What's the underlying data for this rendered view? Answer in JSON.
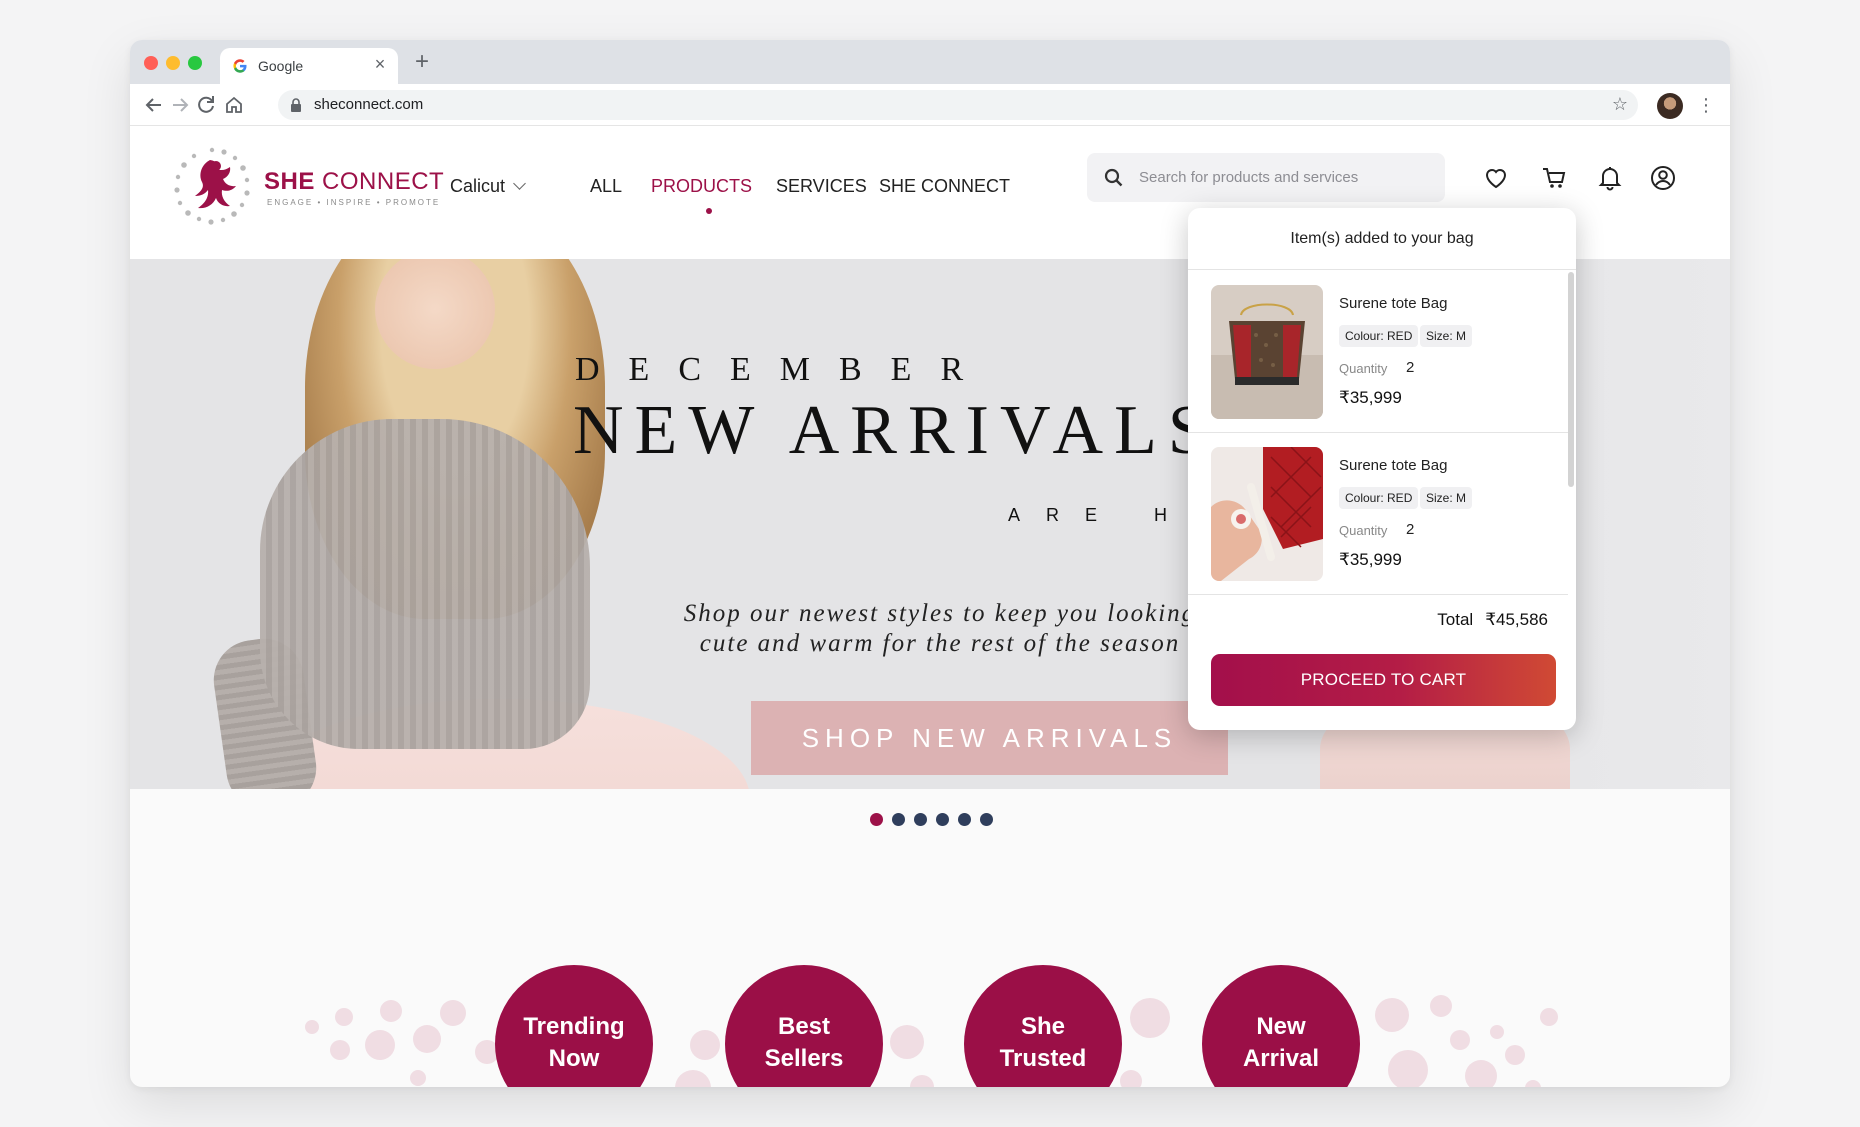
{
  "browser": {
    "tab_title": "Google",
    "tab_close": "×",
    "new_tab": "+",
    "url": "sheconnect.com"
  },
  "site": {
    "logo": {
      "name_bold": "SHE",
      "name_light": "CONNECT",
      "tagline": "ENGAGE • INSPIRE • PROMOTE"
    },
    "location": "Calicut",
    "nav": [
      {
        "label": "ALL",
        "active": false
      },
      {
        "label": "PRODUCTS",
        "active": true
      },
      {
        "label": "SERVICES",
        "active": false
      },
      {
        "label": "SHE CONNECT",
        "active": false
      }
    ],
    "search": {
      "placeholder": "Search for products and services",
      "value": ""
    },
    "brand_color": "#9c1148"
  },
  "hero": {
    "month": "DECEMBER",
    "title": "NEW ARRIVALS",
    "subtitle": "ARE HERE",
    "copy": "Shop our newest styles to keep you looking\ncute and warm for the rest of the season",
    "cta": "SHOP NEW ARRIVALS",
    "slides_total": 6,
    "slide_active": 1
  },
  "cart_popup": {
    "header": "Item(s) added to your bag",
    "items": [
      {
        "name": "Surene tote Bag",
        "colour": "Colour: RED",
        "size": "Size: M",
        "qty_label": "Quantity",
        "qty": "2",
        "price": "₹35,999"
      },
      {
        "name": "Surene tote Bag",
        "colour": "Colour: RED",
        "size": "Size: M",
        "qty_label": "Quantity",
        "qty": "2",
        "price": "₹35,999"
      }
    ],
    "total_label": "Total",
    "total_value": "₹45,586",
    "button": "PROCEED TO CART",
    "button_gradient": [
      "#a30f4b",
      "#d04a34"
    ]
  },
  "categories": [
    {
      "label": "Trending\nNow"
    },
    {
      "label": "Best\nSellers"
    },
    {
      "label": "She\nTrusted"
    },
    {
      "label": "New\nArrival"
    }
  ],
  "icons": [
    "search-icon",
    "wishlist-heart-icon",
    "cart-icon",
    "bell-icon",
    "account-icon",
    "lock-icon",
    "star-icon"
  ]
}
